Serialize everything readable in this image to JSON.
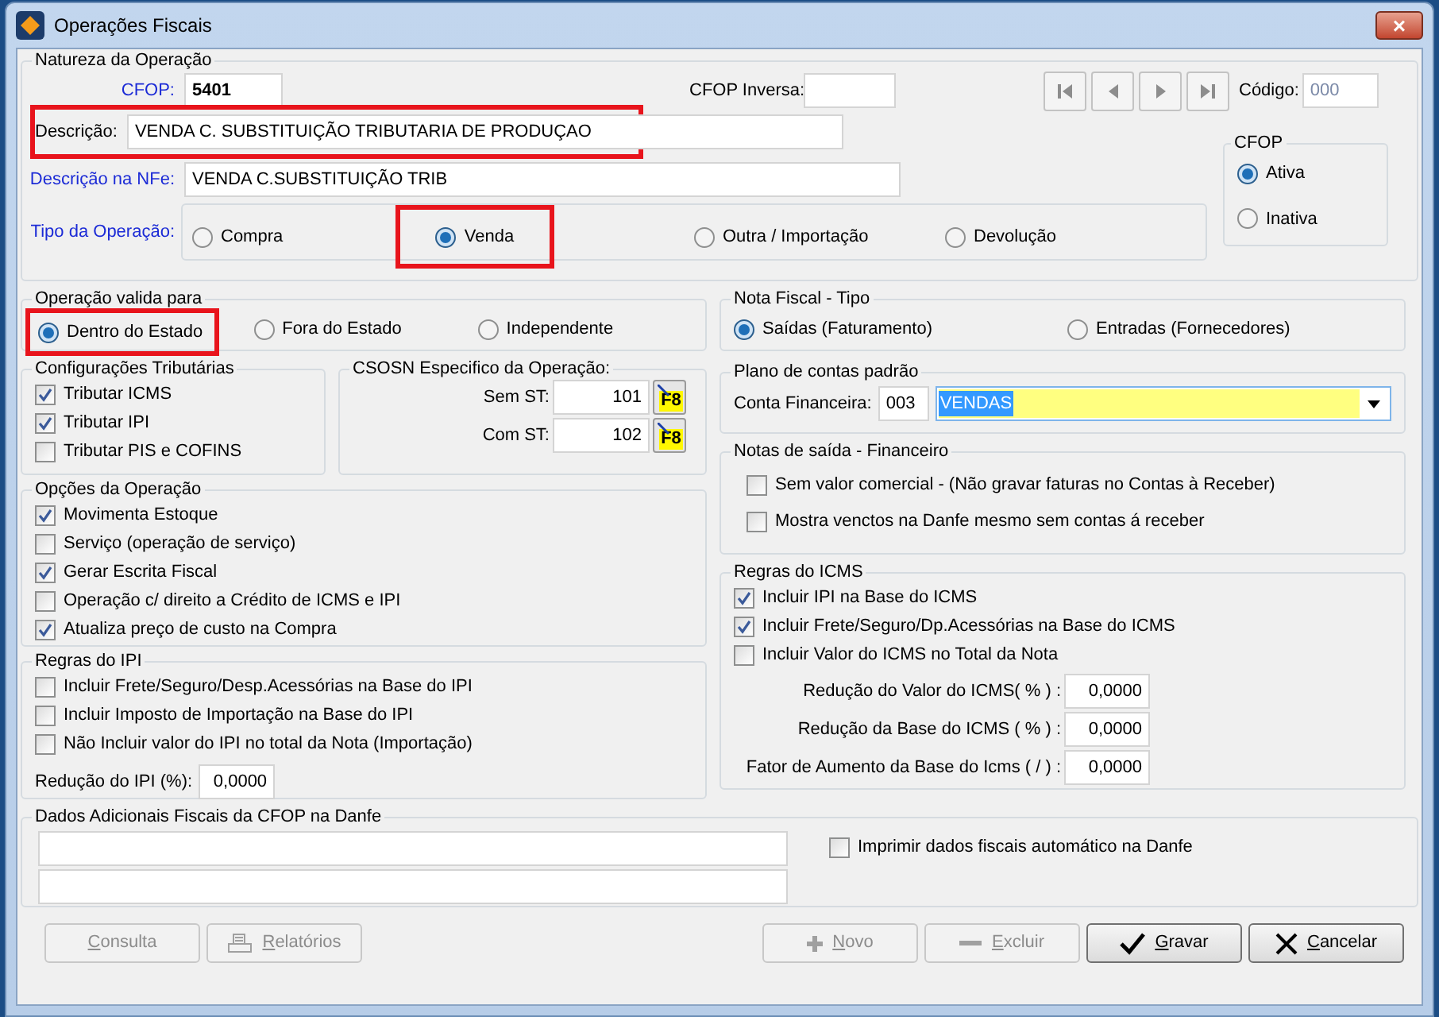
{
  "window": {
    "title": "Operações Fiscais",
    "close": "×"
  },
  "natureza": {
    "title": "Natureza da Operação",
    "cfop": {
      "label": "CFOP:",
      "value": "5401",
      "linked": true
    },
    "cfop_inversa": {
      "label": "CFOP Inversa:",
      "linked": false
    },
    "codigo": {
      "label": "Código:",
      "value": "000"
    },
    "descricao": {
      "label": "Descrição:",
      "value": "VENDA C. SUBSTITUIÇÃO TRIBUTARIA DE PRODUÇAO",
      "linked": false,
      "highlighted": true
    },
    "descricao_nfe": {
      "label": "Descrição na NFe:",
      "value": "VENDA C.SUBSTITUIÇÃO TRIB",
      "linked": true,
      "highlighted": false
    },
    "tipo": {
      "label": "Tipo da Operação:",
      "linked": true,
      "options": [
        {
          "label": "Compra",
          "selected": false,
          "highlighted": false
        },
        {
          "label": "Venda",
          "selected": true,
          "highlighted": true
        },
        {
          "label": "Outra / Importação",
          "selected": false,
          "highlighted": false
        },
        {
          "label": "Devolução",
          "selected": false,
          "highlighted": false
        }
      ]
    },
    "cfop_status": {
      "title": "CFOP",
      "options": [
        {
          "label": "Ativa",
          "selected": true
        },
        {
          "label": "Inativa",
          "selected": false
        }
      ]
    }
  },
  "validade": {
    "title": "Operação valida para",
    "options": [
      {
        "label": "Dentro do Estado",
        "selected": true,
        "highlighted": true
      },
      {
        "label": "Fora do Estado",
        "selected": false,
        "highlighted": false
      },
      {
        "label": "Independente",
        "selected": false,
        "highlighted": false
      }
    ]
  },
  "nota_fiscal_tipo": {
    "title": "Nota Fiscal - Tipo",
    "options": [
      {
        "label": "Saídas (Faturamento)",
        "selected": true
      },
      {
        "label": "Entradas (Fornecedores)",
        "selected": false
      }
    ]
  },
  "config_tributarias": {
    "title": "Configurações Tributárias",
    "items": [
      {
        "label": "Tributar ICMS",
        "checked": true
      },
      {
        "label": "Tributar IPI",
        "checked": true
      },
      {
        "label": "Tributar PIS e COFINS",
        "checked": false
      }
    ]
  },
  "csosn": {
    "title": "CSOSN Especifico da Operação:",
    "rows": [
      {
        "label": "Sem ST:",
        "value": "101",
        "key": "F8"
      },
      {
        "label": "Com ST:",
        "value": "102",
        "key": "F8"
      }
    ]
  },
  "opcoes": {
    "title": "Opções da Operação",
    "items": [
      {
        "label": "Movimenta Estoque",
        "checked": true
      },
      {
        "label": "Serviço (operação de serviço)",
        "checked": false
      },
      {
        "label": "Gerar Escrita Fiscal",
        "checked": true
      },
      {
        "label": "Operação c/ direito a Crédito de ICMS e IPI",
        "checked": false
      },
      {
        "label": "Atualiza preço de custo na Compra",
        "checked": true
      }
    ]
  },
  "regras_ipi": {
    "title": "Regras do IPI",
    "items": [
      {
        "label": "Incluir Frete/Seguro/Desp.Acessórias na Base do IPI",
        "checked": false
      },
      {
        "label": "Incluir Imposto de Importação na Base do IPI",
        "checked": false
      },
      {
        "label": "Não Incluir valor do IPI no total da Nota (Importação)",
        "checked": false
      }
    ],
    "reducao": {
      "label": "Redução do IPI (%):",
      "value": "0,0000"
    }
  },
  "plano_contas": {
    "title": "Plano de contas padrão",
    "label": "Conta Financeira:",
    "code": "003",
    "account": "VENDAS"
  },
  "notas_saida": {
    "title": "Notas de saída - Financeiro",
    "items": [
      {
        "label": "Sem valor comercial  - (Não gravar faturas no Contas à Receber)",
        "checked": false
      },
      {
        "label": "Mostra venctos na Danfe mesmo sem contas á receber",
        "checked": false
      }
    ]
  },
  "regras_icms": {
    "title": "Regras do ICMS",
    "items": [
      {
        "label": "Incluir IPI na Base do ICMS",
        "checked": true
      },
      {
        "label": "Incluir Frete/Seguro/Dp.Acessórias na Base do ICMS",
        "checked": true
      },
      {
        "label": "Incluir Valor do ICMS no Total da Nota",
        "checked": false
      }
    ],
    "fields": [
      {
        "label": "Redução do Valor do ICMS( % ) :",
        "value": "0,0000"
      },
      {
        "label": "Redução da Base do ICMS ( % ) :",
        "value": "0,0000"
      },
      {
        "label": "Fator de Aumento da Base do Icms ( / ) :",
        "value": "0,0000"
      }
    ]
  },
  "dados_adicionais": {
    "title": "Dados Adicionais Fiscais da CFOP na Danfe",
    "checkbox": {
      "label": "Imprimir dados fiscais automático na Danfe",
      "checked": false
    }
  },
  "buttons": [
    {
      "label": "Consulta",
      "kind": "query",
      "disabled": true
    },
    {
      "label": "Relatórios",
      "kind": "report",
      "disabled": true
    },
    {
      "label": "Novo",
      "kind": "new",
      "disabled": true
    },
    {
      "label": "Excluir",
      "kind": "delete",
      "disabled": true
    },
    {
      "label": "Gravar",
      "kind": "save",
      "disabled": false
    },
    {
      "label": "Cancelar",
      "kind": "cancel",
      "disabled": false
    }
  ]
}
